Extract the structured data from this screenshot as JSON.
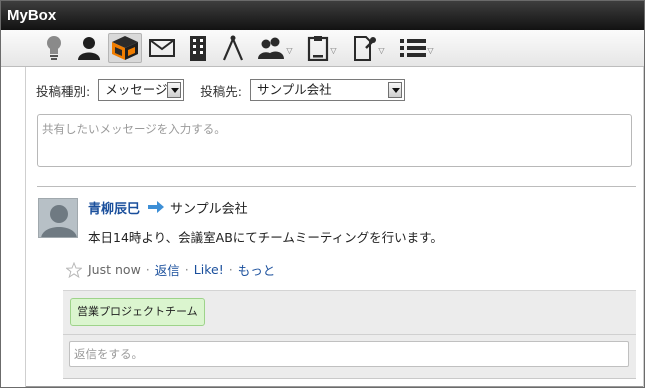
{
  "app": {
    "title": "MyBox"
  },
  "toolbar": {
    "icons": [
      "lightbulb-icon",
      "user-icon",
      "mybox-icon",
      "mail-icon",
      "building-icon",
      "compass-icon",
      "users-icon",
      "clipboard-icon",
      "document-pin-icon",
      "list-icon"
    ]
  },
  "compose": {
    "type_label": "投稿種別:",
    "type_value": "メッセージ",
    "dest_label": "投稿先:",
    "dest_value": "サンプル会社",
    "placeholder": "共有したいメッセージを入力する。"
  },
  "post": {
    "author": "青柳辰巳",
    "target": "サンプル会社",
    "body": "本日14時より、会議室ABにてチームミーティングを行います。",
    "time": "Just now",
    "actions": {
      "reply": "返信",
      "like": "Like!",
      "more": "もっと"
    },
    "tag": "営業プロジェクトチーム",
    "reply_placeholder": "返信をする。"
  },
  "colors": {
    "link": "#1a4f9c",
    "titlebar": "#1e1e1e",
    "tag_bg": "#dbf5cf",
    "accent_orange": "#f07d00"
  }
}
